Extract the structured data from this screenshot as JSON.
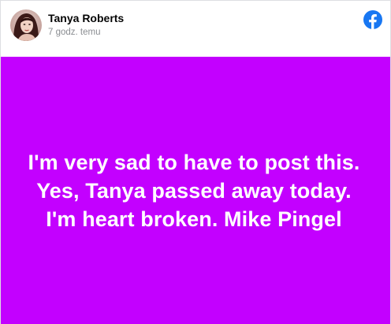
{
  "post": {
    "author": "Tanya Roberts",
    "timestamp": "7 godz. temu",
    "text": "I'm very sad to have to post this. Yes, Tanya passed away today. I'm heart broken. Mike Pingel",
    "background_color": "#c300ff",
    "text_color": "#ffffff"
  },
  "icons": {
    "avatar": "profile-photo",
    "logo": "facebook-logo-icon"
  },
  "colors": {
    "facebook_blue": "#1877f2",
    "author_text": "#050505",
    "timestamp_text": "#8a8d91"
  }
}
